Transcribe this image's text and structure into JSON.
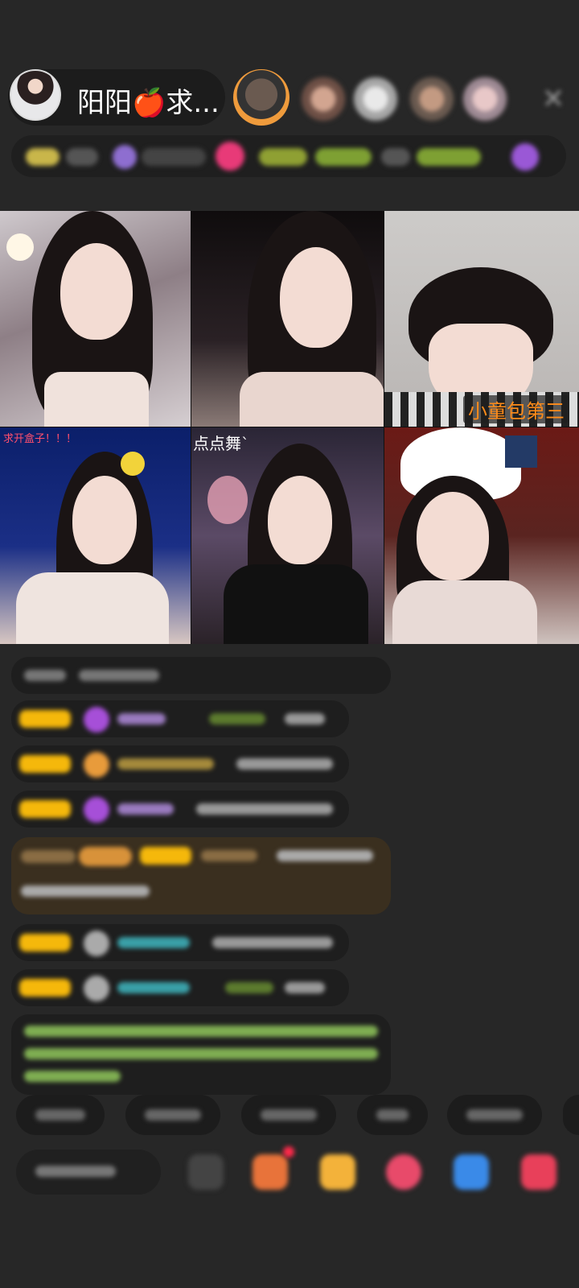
{
  "header": {
    "host_name": "阳阳🍎求...",
    "close_icon_glyph": "✕"
  },
  "video_grid": {
    "tiles": [
      {
        "label": ""
      },
      {
        "label": ""
      },
      {
        "label": "小童包第三"
      },
      {
        "label": "求开盒子！！！"
      },
      {
        "label": "点点舞`"
      },
      {
        "label": ""
      }
    ]
  },
  "colors": {
    "background": "#272727",
    "badge_gold": "#f5b80b",
    "accent_orange": "#ff8c1a",
    "accent_pink": "#ff4f6d",
    "chat_green": "#9bd26a"
  }
}
